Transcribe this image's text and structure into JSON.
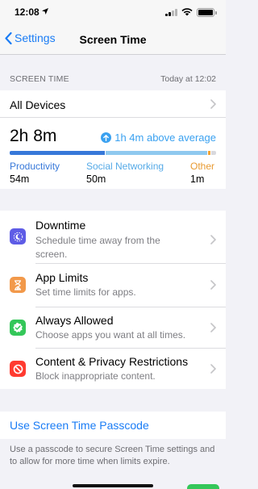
{
  "status_bar": {
    "time": "12:08"
  },
  "nav": {
    "back_label": "Settings",
    "title": "Screen Time"
  },
  "summary": {
    "section_label": "SCREEN TIME",
    "date_label": "Today at 12:02",
    "all_devices_label": "All Devices",
    "total_time": "2h 8m",
    "average_comparison": "1h 4m above average"
  },
  "usage_categories": [
    {
      "name": "Productivity",
      "value": "54m",
      "color": "#3778d9",
      "fraction": 0.46
    },
    {
      "name": "Social Networking",
      "value": "50m",
      "color": "#8fc9ef",
      "fraction": 0.49
    },
    {
      "name": "Other",
      "value": "1m",
      "color": "#f0a336",
      "fraction": 0.01
    }
  ],
  "settings": [
    {
      "title": "Downtime",
      "description": "Schedule time away from the screen.",
      "icon": "moon-icon",
      "color": "#5e5ce6"
    },
    {
      "title": "App Limits",
      "description": "Set time limits for apps.",
      "icon": "hourglass-icon",
      "color": "#f2994a"
    },
    {
      "title": "Always Allowed",
      "description": "Choose apps you want at all times.",
      "icon": "checkmark-icon",
      "color": "#34c759"
    },
    {
      "title": "Content & Privacy Restrictions",
      "description": "Block inappropriate content.",
      "icon": "restriction-icon",
      "color": "#ff3b30"
    }
  ],
  "passcode": {
    "link_label": "Use Screen Time Passcode",
    "footer_note": "Use a passcode to secure Screen Time settings and to allow for more time when limits expire."
  }
}
